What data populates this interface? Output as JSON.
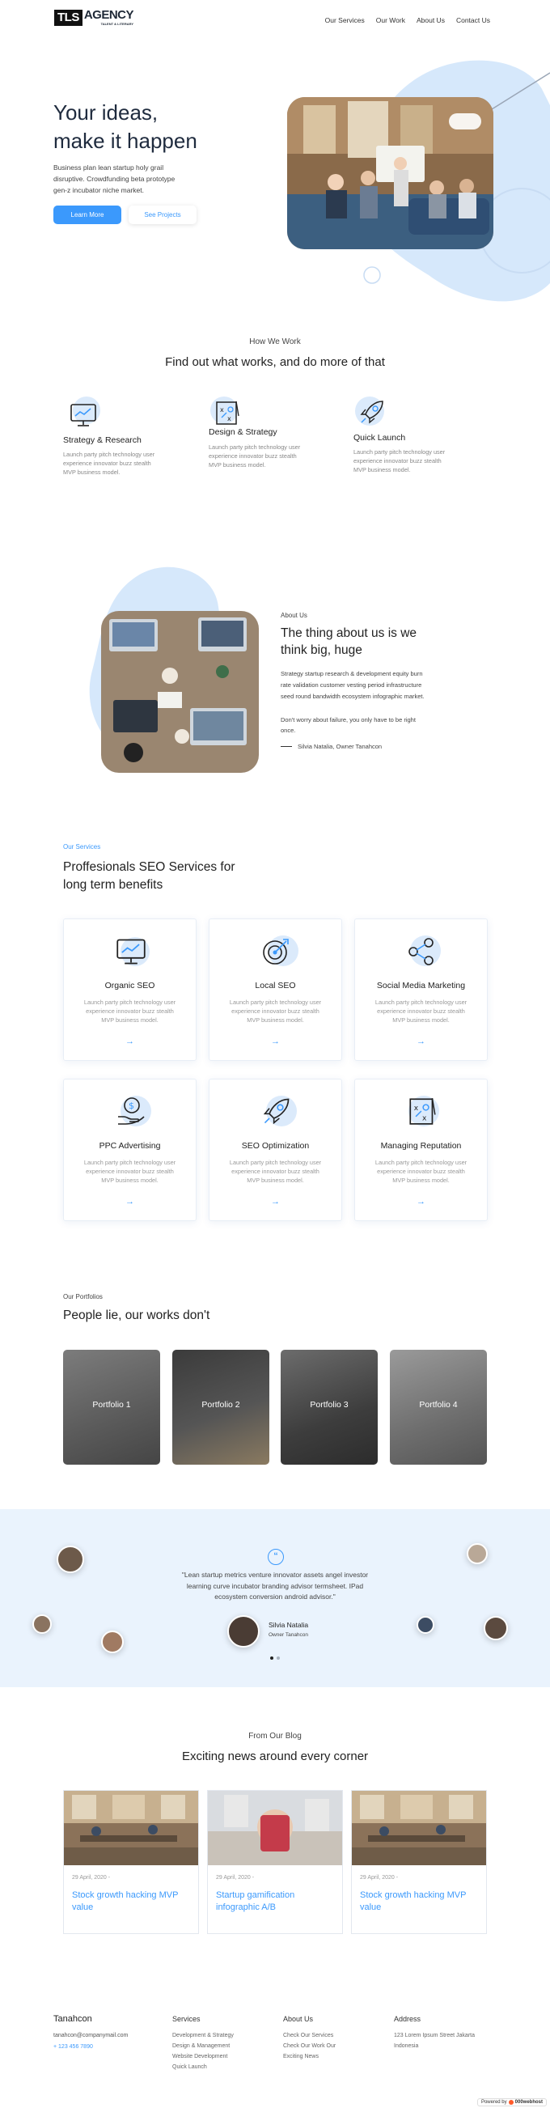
{
  "header": {
    "logo_box": "TLS",
    "logo_word": "AGENCY",
    "logo_tag": "TALENT & LITERARY",
    "nav": [
      "Our Services",
      "Our Work",
      "About Us",
      "Contact Us"
    ]
  },
  "hero": {
    "title_line1": "Your ideas,",
    "title_line2": "make it happen",
    "text": [
      "Business plan lean startup holy grail",
      "disruptive. Crowdfunding beta prototype",
      "gen-z incubator niche market."
    ],
    "primary_button": "Learn More",
    "secondary_button": "See Projects"
  },
  "how": {
    "subtitle": "How We Work",
    "title": "Find out what works, and do more of that",
    "items": [
      {
        "title": "Strategy & Research",
        "icon": "monitor-chart-icon",
        "text": [
          "Launch party pitch technology user",
          "experience innovator buzz stealth",
          "MVP business model."
        ]
      },
      {
        "title": "Design & Strategy",
        "icon": "strategy-board-icon",
        "text": [
          "Launch party pitch technology user",
          "experience innovator buzz stealth",
          "MVP business model."
        ]
      },
      {
        "title": "Quick Launch",
        "icon": "rocket-icon",
        "text": [
          "Launch party pitch technology user",
          "experience innovator buzz stealth",
          "MVP business model."
        ]
      }
    ]
  },
  "about": {
    "label": "About Us",
    "title_line1": "The thing about us is we",
    "title_line2": "think big, huge",
    "text": [
      "Strategy startup research & development equity burn",
      "rate validation customer vesting period infrastructure",
      "seed round bandwidth ecosystem infographic market."
    ],
    "quote": [
      "Don't worry about failure, you only have to be right",
      "once."
    ],
    "author": "Silvia Natalia, Owner Tanahcon"
  },
  "services": {
    "label": "Our Services",
    "title_line1": "Proffesionals SEO Services for",
    "title_line2": "long term benefits",
    "items": [
      {
        "title": "Organic SEO",
        "icon": "monitor-chart-icon"
      },
      {
        "title": "Local SEO",
        "icon": "target-icon"
      },
      {
        "title": "Social Media Marketing",
        "icon": "share-icon"
      },
      {
        "title": "PPC Advertising",
        "icon": "dollar-hand-icon"
      },
      {
        "title": "SEO Optimization",
        "icon": "rocket-icon"
      },
      {
        "title": "Managing Reputation",
        "icon": "strategy-board-icon"
      }
    ],
    "item_text": [
      "Launch party pitch technology user",
      "experience innovator buzz stealth",
      "MVP business model."
    ],
    "arrow": "→"
  },
  "portfolio": {
    "label": "Our Portfolios",
    "title": "People lie, our works don't",
    "items": [
      "Portfolio 1",
      "Portfolio 2",
      "Portfolio 3",
      "Portfolio 4"
    ]
  },
  "testimonial": {
    "quote": [
      "\"Lean startup metrics venture innovator assets angel investor",
      "learning curve incubator branding advisor termsheet. IPad",
      "ecosystem conversion android advisor.\""
    ],
    "name": "Silvia Natalia",
    "role": "Owner Tanahcon"
  },
  "blog": {
    "subtitle": "From Our Blog",
    "title": "Exciting news around every corner",
    "posts": [
      {
        "date": "29 April, 2020 -",
        "title": "Stock growth hacking MVP value"
      },
      {
        "date": "29 April, 2020 -",
        "title": "Startup gamification infographic A/B"
      },
      {
        "date": "29 April, 2020 -",
        "title": "Stock growth hacking MVP value"
      }
    ]
  },
  "footer": {
    "brand": "Tanahcon",
    "email": "tanahcon@companymail.com",
    "phone": "+ 123 456 7890",
    "services_title": "Services",
    "services": [
      "Development & Strategy",
      "Design & Management",
      "Website Development",
      "Quick Launch"
    ],
    "about_title": "About Us",
    "about": [
      "Check Our Services",
      "Check Our Work Our",
      "Exciting News"
    ],
    "address_title": "Address",
    "address": [
      "123 Lorem Ipsum Street Jakarta",
      "Indonesia"
    ],
    "badge_prefix": "Powered by",
    "badge_brand": "000webhost"
  },
  "colors": {
    "accent": "#3b99fc",
    "light_blue": "#eaf3fd",
    "blob": "#d6e8fb"
  }
}
